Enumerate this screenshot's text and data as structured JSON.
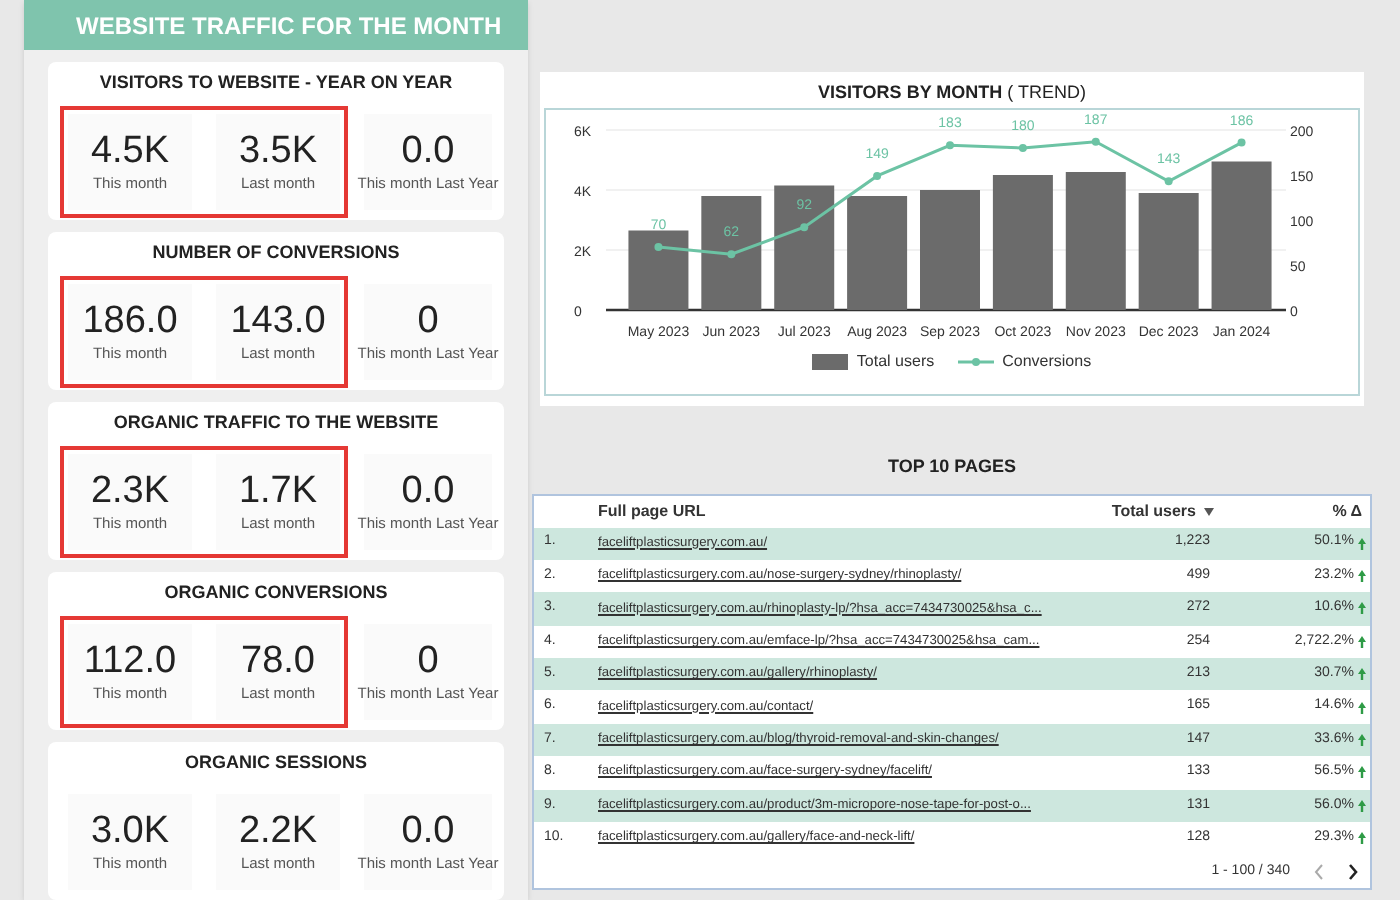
{
  "header": {
    "title": "WEBSITE TRAFFIC FOR THE MONTH"
  },
  "cards": [
    {
      "title": "VISITORS TO WEBSITE - YEAR ON YEAR",
      "highlighted": true,
      "stats": [
        {
          "value": "4.5K",
          "label": "This month"
        },
        {
          "value": "3.5K",
          "label": "Last month"
        },
        {
          "value": "0.0",
          "label": "This month Last Year"
        }
      ]
    },
    {
      "title": "NUMBER OF CONVERSIONS",
      "highlighted": true,
      "stats": [
        {
          "value": "186.0",
          "label": "This month"
        },
        {
          "value": "143.0",
          "label": "Last month"
        },
        {
          "value": "0",
          "label": "This month Last Year"
        }
      ]
    },
    {
      "title": "ORGANIC TRAFFIC TO THE WEBSITE",
      "highlighted": true,
      "stats": [
        {
          "value": "2.3K",
          "label": "This month"
        },
        {
          "value": "1.7K",
          "label": "Last month"
        },
        {
          "value": "0.0",
          "label": "This month Last Year"
        }
      ]
    },
    {
      "title": "ORGANIC CONVERSIONS",
      "highlighted": true,
      "stats": [
        {
          "value": "112.0",
          "label": "This month"
        },
        {
          "value": "78.0",
          "label": "Last month"
        },
        {
          "value": "0",
          "label": "This month Last Year"
        }
      ]
    },
    {
      "title": "ORGANIC SESSIONS",
      "highlighted": false,
      "stats": [
        {
          "value": "3.0K",
          "label": "This month"
        },
        {
          "value": "2.2K",
          "label": "Last month"
        },
        {
          "value": "0.0",
          "label": "This month Last Year"
        }
      ]
    }
  ],
  "chart": {
    "title": "VISITORS BY MONTH",
    "subtitle": "( TREND)",
    "chart_data": {
      "type": "bar",
      "categories": [
        "May 2023",
        "Jun 2023",
        "Jul 2023",
        "Aug 2023",
        "Sep 2023",
        "Oct 2023",
        "Nov 2023",
        "Dec 2023",
        "Jan 2024"
      ],
      "series": [
        {
          "name": "Total users",
          "type": "bar",
          "color": "#6b6b6b",
          "values": [
            2650,
            3800,
            4150,
            3800,
            4000,
            4500,
            4600,
            3900,
            4950
          ]
        },
        {
          "name": "Conversions",
          "type": "line",
          "axis": "y2",
          "marker": "circle",
          "color": "#6cc3a4",
          "values": [
            70,
            62,
            92,
            149,
            183,
            180,
            187,
            143,
            186
          ]
        }
      ],
      "ylim": [
        0,
        6000
      ],
      "yticks": [
        {
          "value": 0,
          "label": "0"
        },
        {
          "value": 2000,
          "label": "2K"
        },
        {
          "value": 4000,
          "label": "4K"
        },
        {
          "value": 6000,
          "label": "6K"
        }
      ],
      "y2lim": [
        0,
        200
      ],
      "y2ticks": [
        0,
        50,
        100,
        150,
        200
      ],
      "legend": "bottom",
      "value_labels": [
        [
          null,
          null,
          null,
          null,
          null,
          null,
          null,
          null,
          null
        ],
        [
          "70",
          "62",
          "92",
          "149",
          "183",
          "180",
          "187",
          "143",
          "186"
        ]
      ]
    }
  },
  "table": {
    "title": "TOP 10 PAGES",
    "columns": [
      "Full page URL",
      "Total users",
      "% Δ"
    ],
    "rows": [
      {
        "num": "1.",
        "url": "faceliftplasticsurgery.com.au/",
        "users": "1,223",
        "change": "50.1%"
      },
      {
        "num": "2.",
        "url": "faceliftplasticsurgery.com.au/nose-surgery-sydney/rhinoplasty/",
        "users": "499",
        "change": "23.2%"
      },
      {
        "num": "3.",
        "url": "faceliftplasticsurgery.com.au/rhinoplasty-lp/?hsa_acc=7434730025&hsa_c...",
        "users": "272",
        "change": "10.6%"
      },
      {
        "num": "4.",
        "url": "faceliftplasticsurgery.com.au/emface-lp/?hsa_acc=7434730025&hsa_cam...",
        "users": "254",
        "change": "2,722.2%"
      },
      {
        "num": "5.",
        "url": "faceliftplasticsurgery.com.au/gallery/rhinoplasty/",
        "users": "213",
        "change": "30.7%"
      },
      {
        "num": "6.",
        "url": "faceliftplasticsurgery.com.au/contact/",
        "users": "165",
        "change": "14.6%"
      },
      {
        "num": "7.",
        "url": "faceliftplasticsurgery.com.au/blog/thyroid-removal-and-skin-changes/",
        "users": "147",
        "change": "33.6%"
      },
      {
        "num": "8.",
        "url": "faceliftplasticsurgery.com.au/face-surgery-sydney/facelift/",
        "users": "133",
        "change": "56.5%"
      },
      {
        "num": "9.",
        "url": "faceliftplasticsurgery.com.au/product/3m-micropore-nose-tape-for-post-o...",
        "users": "131",
        "change": "56.0%"
      },
      {
        "num": "10.",
        "url": "faceliftplasticsurgery.com.au/gallery/face-and-neck-lift/",
        "users": "128",
        "change": "29.3%"
      }
    ],
    "pagination": "1 - 100 / 340"
  }
}
